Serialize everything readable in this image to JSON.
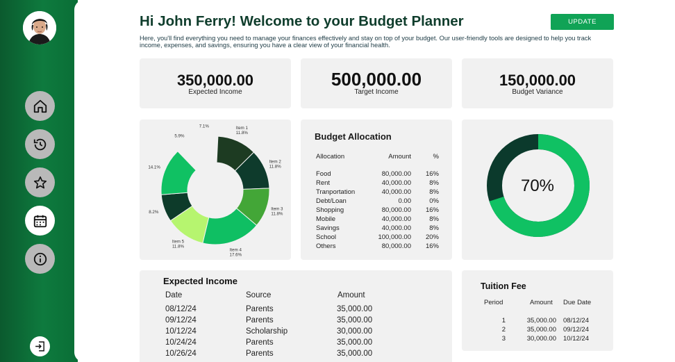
{
  "header": {
    "title": "Hi John Ferry! Welcome to your Budget Planner",
    "subtitle": "Here, you'll find everything you need to manage your finances effectively and stay on top of your budget. Our user-friendly tools are designed to help you track income, expenses, and savings, ensuring you have a clear view of your financial health.",
    "update_label": "UPDATE"
  },
  "sidebar": {
    "items": [
      {
        "icon": "home-icon",
        "active": false
      },
      {
        "icon": "history-icon",
        "active": false
      },
      {
        "icon": "star-icon",
        "active": false
      },
      {
        "icon": "calendar-icon",
        "active": true
      },
      {
        "icon": "info-icon",
        "active": false
      }
    ],
    "logout_icon": "logout-icon"
  },
  "stats": {
    "expected_income": {
      "value": "350,000.00",
      "label": "Expected Income"
    },
    "target_income": {
      "value": "500,000.00",
      "label": "Target Income"
    },
    "budget_variance": {
      "value": "150,000.00",
      "label": "Budget Variance"
    }
  },
  "allocation": {
    "title": "Budget Allocation",
    "headers": [
      "Allocation",
      "Amount",
      "%"
    ],
    "rows": [
      {
        "name": "Food",
        "amount": "80,000.00",
        "pct": "16%"
      },
      {
        "name": "Rent",
        "amount": "40,000.00",
        "pct": "8%"
      },
      {
        "name": "Tranportation",
        "amount": "40,000.00",
        "pct": "8%"
      },
      {
        "name": "Debt/Loan",
        "amount": "0.00",
        "pct": "0%"
      },
      {
        "name": "Shopping",
        "amount": "80,000.00",
        "pct": "16%"
      },
      {
        "name": "Mobile",
        "amount": "40,000.00",
        "pct": "8%"
      },
      {
        "name": "Savings",
        "amount": "40,000.00",
        "pct": "8%"
      },
      {
        "name": "School",
        "amount": "100,000.00",
        "pct": "20%"
      },
      {
        "name": "Others",
        "amount": "80,000.00",
        "pct": "16%"
      }
    ]
  },
  "progress": {
    "label": "70%",
    "fraction": 0.7,
    "track_color": "#0b3a2c",
    "fill_color": "#10c163"
  },
  "income_table": {
    "title": "Expected Income",
    "headers": [
      "Date",
      "Source",
      "Amount"
    ],
    "rows": [
      {
        "date": "08/12/24",
        "source": "Parents",
        "amount": "35,000.00"
      },
      {
        "date": "09/12/24",
        "source": "Parents",
        "amount": "35,000.00"
      },
      {
        "date": "10/12/24",
        "source": "Scholarship",
        "amount": "30,000.00"
      },
      {
        "date": "10/24/24",
        "source": "Parents",
        "amount": "35,000.00"
      },
      {
        "date": "10/26/24",
        "source": "Parents",
        "amount": "35,000.00"
      }
    ]
  },
  "tuition": {
    "title": "Tuition Fee",
    "headers": [
      "Period",
      "Amount",
      "Due Date"
    ],
    "rows": [
      {
        "period": "1",
        "amount": "35,000.00",
        "due": "08/12/24"
      },
      {
        "period": "2",
        "amount": "35,000.00",
        "due": "09/12/24"
      },
      {
        "period": "3",
        "amount": "30,000.00",
        "due": "10/12/24"
      }
    ]
  },
  "chart_data": {
    "type": "pie",
    "donut": true,
    "slices": [
      {
        "label": "Item 1",
        "pct_label": "11.8%",
        "value": 11.8,
        "color": "#1d3b22"
      },
      {
        "label": "Item 2",
        "pct_label": "11.8%",
        "value": 11.8,
        "color": "#0e3b2c"
      },
      {
        "label": "Item 3",
        "pct_label": "11.8%",
        "value": 11.8,
        "color": "#43a637"
      },
      {
        "label": "Item 4",
        "pct_label": "17.6%",
        "value": 17.6,
        "color": "#0fbf63"
      },
      {
        "label": "Item 5",
        "pct_label": "11.8%",
        "value": 11.8,
        "color": "#b6f56f"
      },
      {
        "label": "",
        "pct_label": "8.2%",
        "value": 8.2,
        "color": "#0d3b2a"
      },
      {
        "label": "",
        "pct_label": "14.1%",
        "value": 14.1,
        "color": "#10c163"
      },
      {
        "label": "",
        "pct_label": "5.9%",
        "value": 5.9,
        "color": "#ffffff"
      },
      {
        "label": "",
        "pct_label": "7.1%",
        "value": 7.1,
        "color": "#ffffff"
      }
    ]
  }
}
